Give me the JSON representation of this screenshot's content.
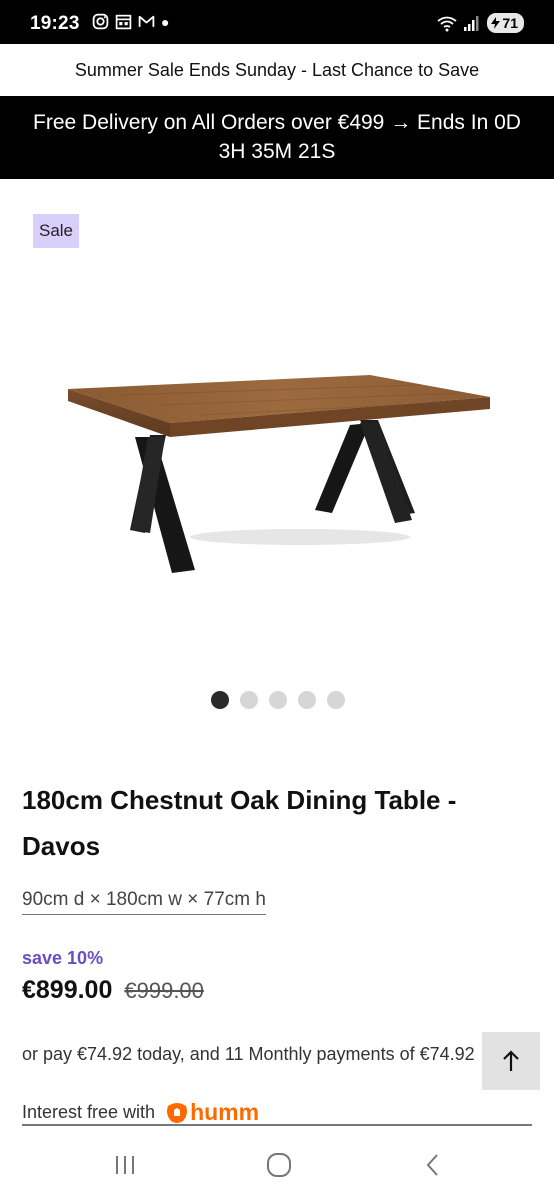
{
  "status_bar": {
    "time": "19:23",
    "battery": "71",
    "icons": [
      "instagram-icon",
      "calendar-icon",
      "gmail-icon",
      "notification-dot",
      "wifi-icon",
      "signal-icon",
      "battery-icon"
    ]
  },
  "promo": {
    "line1": "Summer Sale Ends Sunday - Last Chance to Save",
    "line2": "Free Delivery on All Orders over €499 → Ends In 0D 3H 35M 21S"
  },
  "gallery": {
    "badge": "Sale",
    "image_count": 5,
    "active_index": 0
  },
  "product": {
    "title": "180cm Chestnut Oak Dining Table - Davos",
    "dimensions": "90cm d × 180cm w × 77cm h",
    "save_label": "save 10%",
    "price": "€899.00",
    "old_price": "€999.00",
    "installments": "or pay €74.92 today, and 11 Monthly payments of €74.92",
    "interest_free_label": "Interest free with",
    "finance_brand": "humm"
  },
  "colors": {
    "accent": "#6a4fc4",
    "badge_bg": "#d8cffb",
    "humm_orange": "#ff6a00",
    "promo_bg": "#000000"
  },
  "nav": {
    "icons": [
      "recent-apps-icon",
      "home-icon",
      "back-icon"
    ]
  }
}
